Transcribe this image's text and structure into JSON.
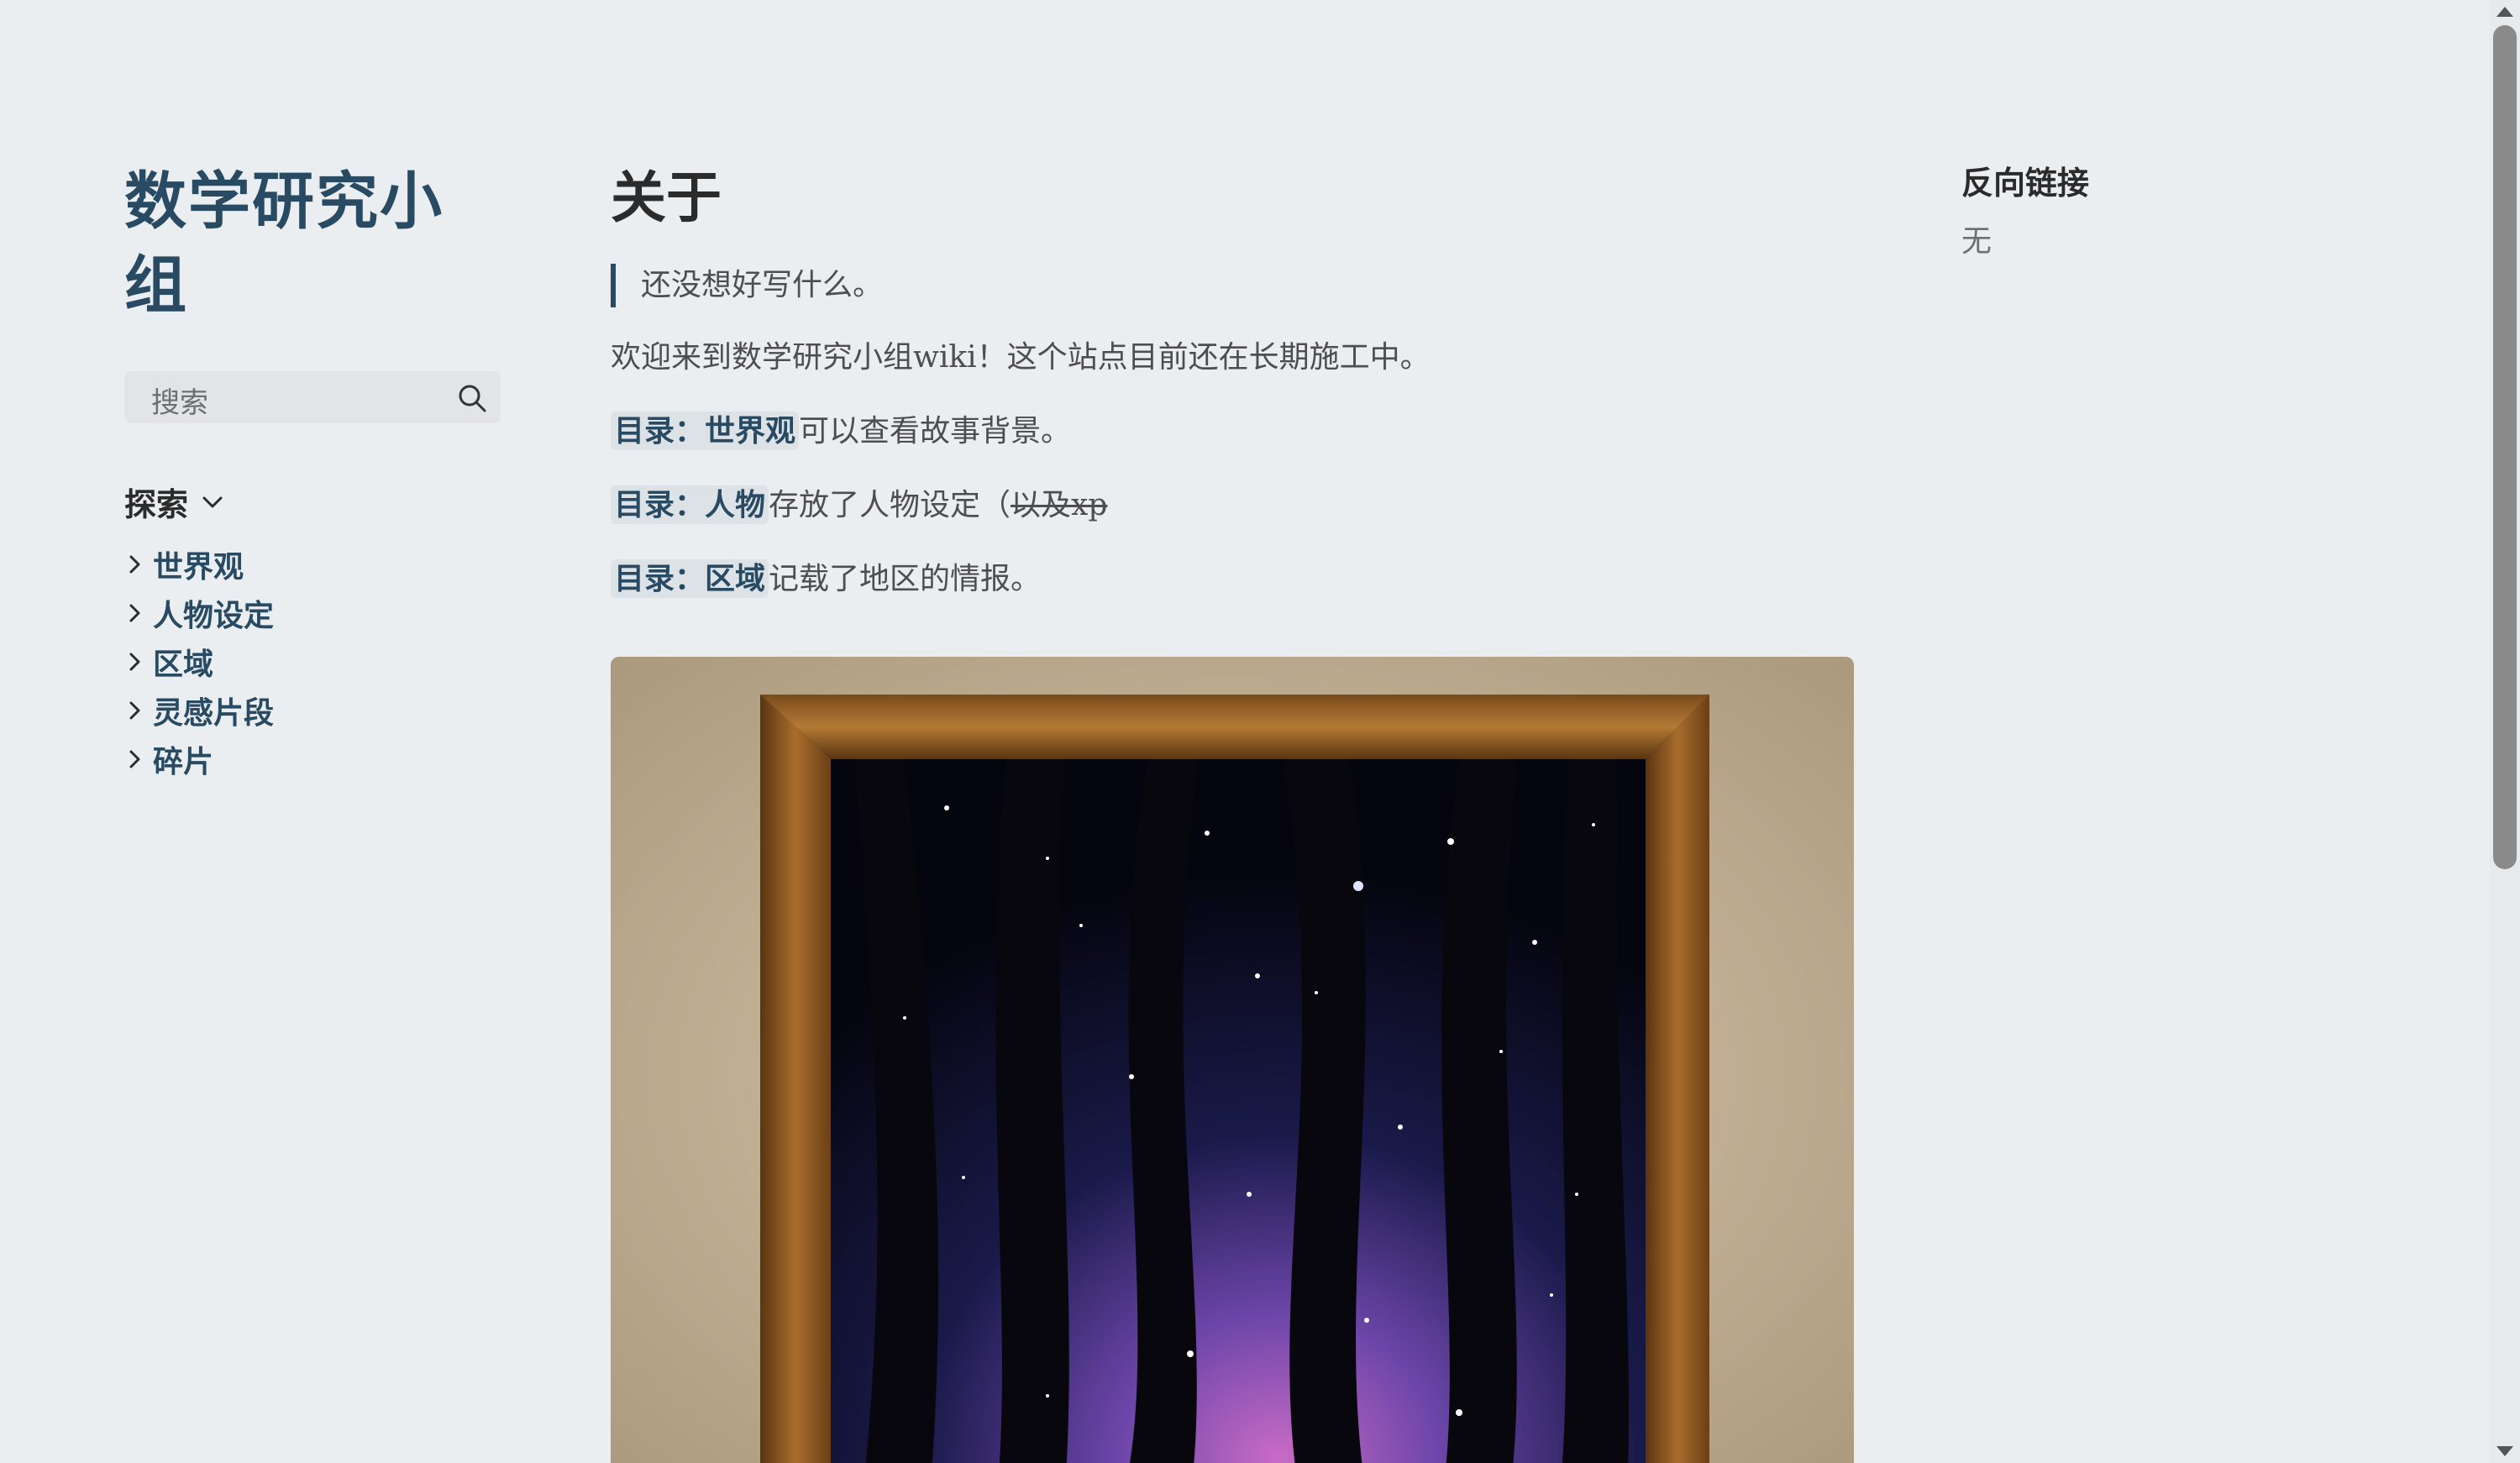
{
  "sidebar": {
    "site_title": "数学研究小组",
    "search_placeholder": "搜索",
    "explorer_title": "探索",
    "items": [
      {
        "label": "世界观"
      },
      {
        "label": "人物设定"
      },
      {
        "label": "区域"
      },
      {
        "label": "灵感片段"
      },
      {
        "label": "碎片"
      }
    ]
  },
  "main": {
    "title": "关于",
    "quote": "还没想好写什么。",
    "welcome": "欢迎来到数学研究小组wiki！这个站点目前还在长期施工中。",
    "links": [
      {
        "link": "目录：世界观",
        "after": "可以查看故事背景。"
      },
      {
        "link": "目录：人物",
        "after": "存放了人物设定（",
        "strike": "以及xp"
      },
      {
        "link": "目录：区域",
        "after": "记载了地区的情报。"
      }
    ]
  },
  "right": {
    "backlinks_title": "反向链接",
    "backlinks_empty": "无"
  },
  "icons": {
    "search": "search-icon",
    "explorer_toggle": "chevron-down-icon",
    "folder": "chevron-right-icon"
  },
  "colors": {
    "background": "#ebeef1",
    "accent": "#284b63",
    "link_highlight": "#dde2e7"
  }
}
